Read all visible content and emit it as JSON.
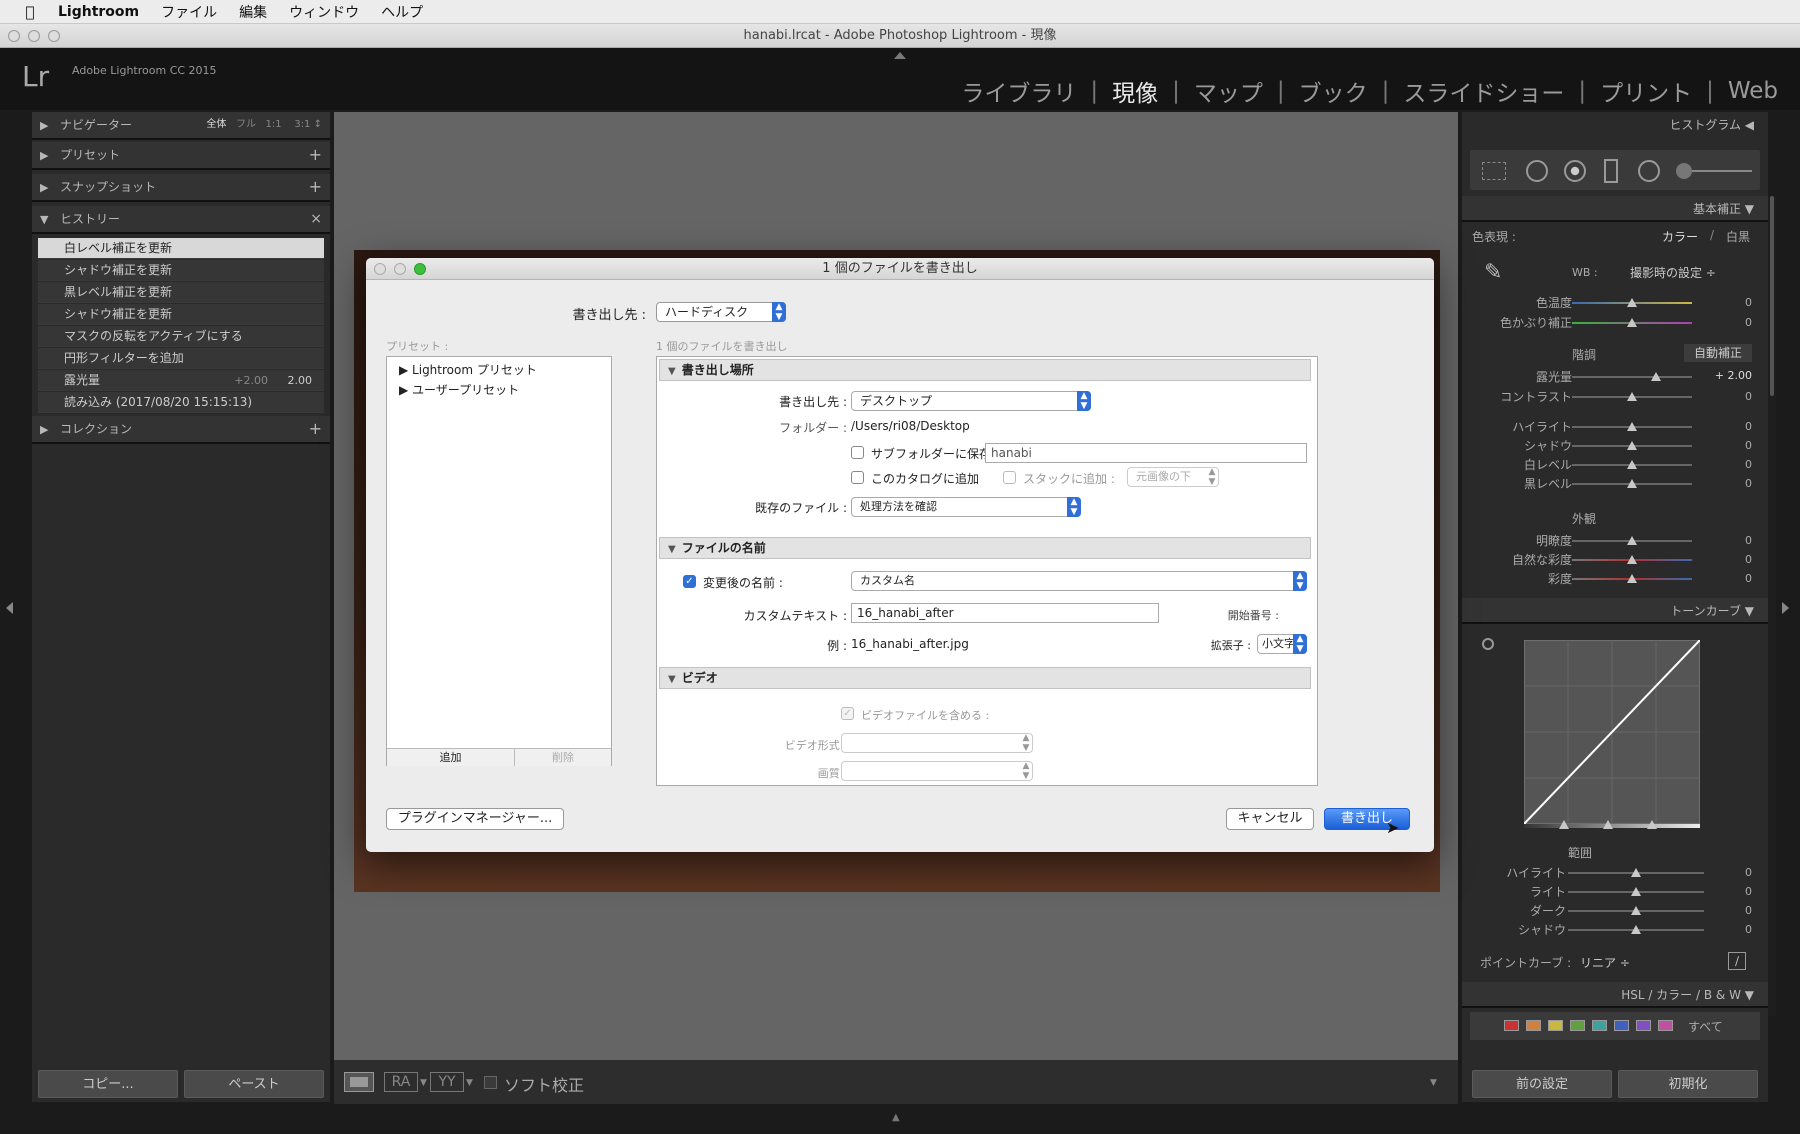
{
  "menubar": {
    "app": "Lightroom",
    "items": [
      "ファイル",
      "編集",
      "ウィンドウ",
      "ヘルプ"
    ]
  },
  "window": {
    "title": "hanabi.lrcat - Adobe Photoshop Lightroom - 現像"
  },
  "header": {
    "logo": "Lr",
    "version": "Adobe Lightroom CC 2015",
    "modules": [
      "ライブラリ",
      "現像",
      "マップ",
      "ブック",
      "スライドショー",
      "プリント",
      "Web"
    ],
    "active_module": "現像"
  },
  "left_panel": {
    "navigator": {
      "label": "ナビゲーター",
      "zoom": [
        "全体",
        "フル",
        "1:1",
        "3:1"
      ]
    },
    "presets": {
      "label": "プリセット"
    },
    "snapshots": {
      "label": "スナップショット"
    },
    "history": {
      "label": "ヒストリー",
      "items": [
        "白レベル補正を更新",
        "シャドウ補正を更新",
        "黒レベル補正を更新",
        "シャドウ補正を更新",
        "マスクの反転をアクティブにする",
        "円形フィルターを追加",
        "露光量",
        "読み込み (2017/08/20 15:15:13)"
      ],
      "exposure_delta": "+2.00",
      "exposure_value": "2.00"
    },
    "collections": {
      "label": "コレクション"
    },
    "copy_button": "コピー...",
    "paste_button": "ペースト"
  },
  "bottom_toolbar": {
    "soft_proof": "ソフト校正"
  },
  "right_panel": {
    "histogram": "ヒストグラム",
    "basic": "基本補正",
    "treatment_label": "色表現 :",
    "treatment_color": "カラー",
    "treatment_bw": "白黒",
    "wb_label": "WB :",
    "wb_value": "撮影時の設定 ÷",
    "temp_label": "色温度",
    "tint_label": "色かぶり補正",
    "tone_label": "階調",
    "auto_label": "自動補正",
    "exposure_label": "露光量",
    "exposure_value": "+ 2.00",
    "contrast_label": "コントラスト",
    "highlights_label": "ハイライト",
    "shadows_label": "シャドウ",
    "whites_label": "白レベル",
    "blacks_label": "黒レベル",
    "presence_label": "外観",
    "clarity_label": "明瞭度",
    "vibrance_label": "自然な彩度",
    "saturation_label": "彩度",
    "zero": "0",
    "tone_curve": "トーンカーブ",
    "region_label": "範囲",
    "curve_highlights": "ハイライト",
    "curve_lights": "ライト",
    "curve_darks": "ダーク",
    "curve_shadows": "シャドウ",
    "point_curve_label": "ポイントカーブ :",
    "point_curve_value": "リニア ÷",
    "hsl_header": "HSL / カラー / B & W",
    "hsl_all": "すべて",
    "prev_button": "前の設定",
    "reset_button": "初期化"
  },
  "dialog": {
    "title": "1 個のファイルを書き出し",
    "export_to_label": "書き出し先 :",
    "export_to_value": "ハードディスク",
    "presets_label": "プリセット :",
    "files_count_label": "1 個のファイルを書き出し",
    "preset_groups": [
      "Lightroom プリセット",
      "ユーザープリセット"
    ],
    "add_button": "追加",
    "remove_button": "削除",
    "sections": {
      "location": {
        "title": "書き出し場所",
        "dest_label": "書き出し先 :",
        "dest_value": "デスクトップ",
        "folder_label": "フォルダー :",
        "folder_value": "/Users/ri08/Desktop",
        "subfolder_label": "サブフォルダーに保存 :",
        "subfolder_value": "hanabi",
        "add_catalog_label": "このカタログに追加",
        "stack_label": "スタックに追加 :",
        "stack_value": "元画像の下",
        "existing_label": "既存のファイル :",
        "existing_value": "処理方法を確認"
      },
      "naming": {
        "title": "ファイルの名前",
        "rename_label": "変更後の名前 :",
        "rename_value": "カスタム名",
        "custom_text_label": "カスタムテキスト :",
        "custom_text_value": "16_hanabi_after",
        "start_number_label": "開始番号 :",
        "example_label": "例 :",
        "example_value": "16_hanabi_after.jpg",
        "extension_label": "拡張子 :",
        "extension_value": "小文字"
      },
      "video": {
        "title": "ビデオ",
        "include_label": "ビデオファイルを含める :",
        "format_label": "ビデオ形式 :",
        "quality_label": "画質 :"
      }
    },
    "plugin_manager_button": "プラグインマネージャー...",
    "cancel_button": "キャンセル",
    "export_button": "書き出し"
  },
  "colors": {
    "accent": "#2f6fd6",
    "panel": "#2a2a2a"
  }
}
